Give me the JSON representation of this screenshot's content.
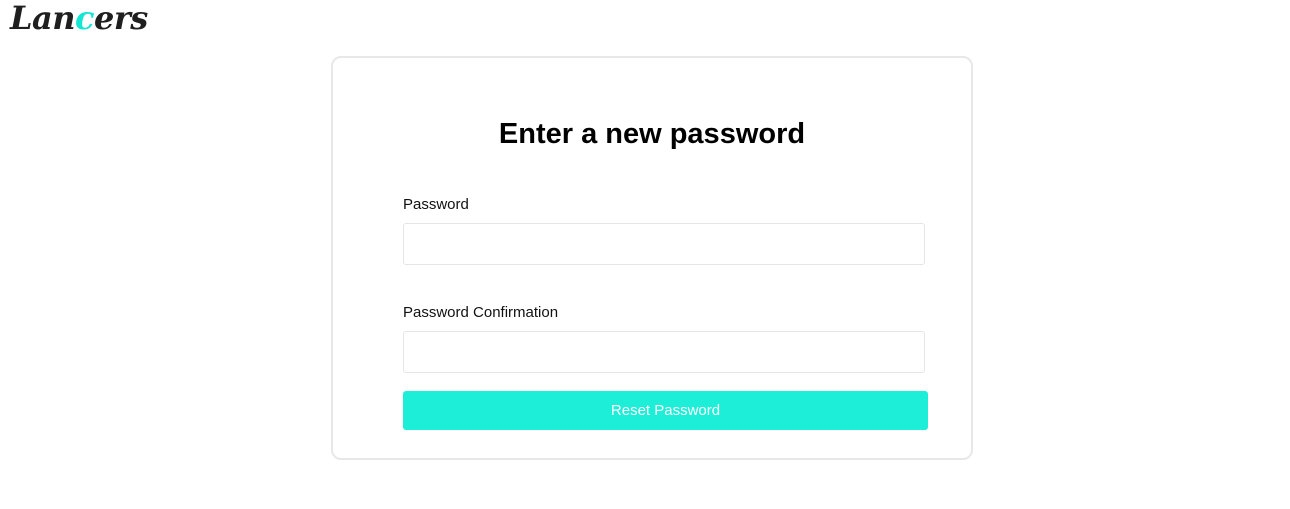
{
  "brand": {
    "logo_part1": "Lan",
    "logo_accent": "c",
    "logo_part2": "ers",
    "accent_color": "#14e6d4"
  },
  "form": {
    "title": "Enter a new password",
    "password_label": "Password",
    "password_value": "",
    "password_placeholder": "",
    "confirmation_label": "Password Confirmation",
    "confirmation_value": "",
    "confirmation_placeholder": "",
    "submit_label": "Reset Password",
    "submit_color": "#1ceed8"
  }
}
